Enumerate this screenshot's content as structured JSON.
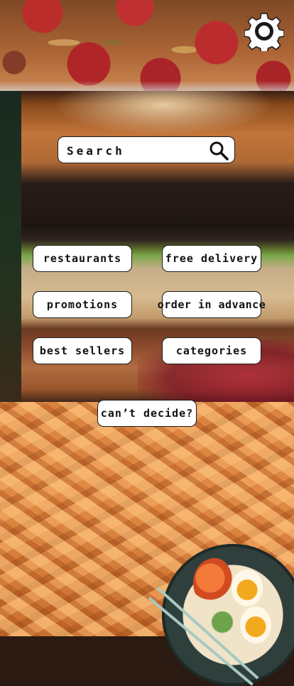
{
  "header": {
    "settings_icon": "gear-icon"
  },
  "search": {
    "placeholder": "Search",
    "icon": "search-icon"
  },
  "buttons": {
    "restaurants": "restaurants",
    "free_delivery": "free delivery",
    "promotions": "promotions",
    "order_in_advance": "order in advance",
    "best_sellers": "best sellers",
    "categories": "categories",
    "cant_decide": "can’t decide?"
  },
  "colors": {
    "button_bg": "#ffffff",
    "button_border": "#1a1a1a",
    "text": "#111111"
  }
}
